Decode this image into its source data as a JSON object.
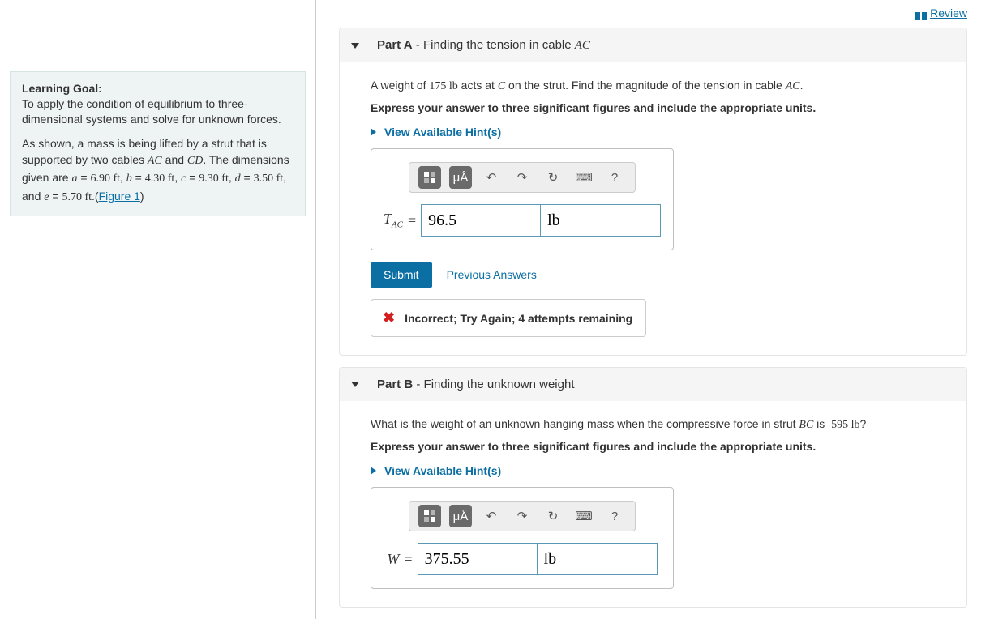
{
  "review_label": "Review",
  "goal": {
    "title": "Learning Goal:",
    "text": "To apply the condition of equilibrium to three-dimensional systems and solve for unknown forces.",
    "intro": "As shown, a mass is being lifted by a strut that is supported by two cables ",
    "cable1": "AC",
    "and": " and ",
    "cable2": "CD",
    "dims_lead": ". The dimensions given are ",
    "a_val": "6.90 ft",
    "b_val": "4.30 ft",
    "c_val": "9.30 ft",
    "d_val": "3.50 ft",
    "e_val": "5.70 ft",
    "fig_label": "Figure 1"
  },
  "partA": {
    "label": "Part A",
    "title_dash": " - ",
    "title_text": "Finding the tension in cable ",
    "title_var": "AC",
    "prompt_pre": "A weight of ",
    "weight": "175 lb",
    "prompt_mid": " acts at ",
    "point": "C",
    "prompt_post": " on the strut. Find the magnitude of the tension in cable ",
    "cable": "AC",
    "express": "Express your answer to three significant figures and include the appropriate units.",
    "hints": "View Available Hint(s)",
    "var_main": "T",
    "var_sub": "AC",
    "value": "96.5",
    "unit": "lb",
    "submit": "Submit",
    "prev": "Previous Answers",
    "feedback": "Incorrect; Try Again; 4 attempts remaining"
  },
  "partB": {
    "label": "Part B",
    "title_dash": " - ",
    "title_text": "Finding the unknown weight",
    "prompt_pre": "What is the weight of an unknown hanging mass when the compressive force in strut ",
    "strut": "BC",
    "prompt_mid": " is ",
    "force": "595 lb",
    "prompt_post": "?",
    "express": "Express your answer to three significant figures and include the appropriate units.",
    "hints": "View Available Hint(s)",
    "var_main": "W",
    "value": "375.55",
    "unit": "lb"
  },
  "toolbar": {
    "templates": "▭",
    "symbols": "μÅ",
    "undo": "↶",
    "redo": "↷",
    "reset": "↻",
    "keyboard": "⌨",
    "help": "?"
  }
}
